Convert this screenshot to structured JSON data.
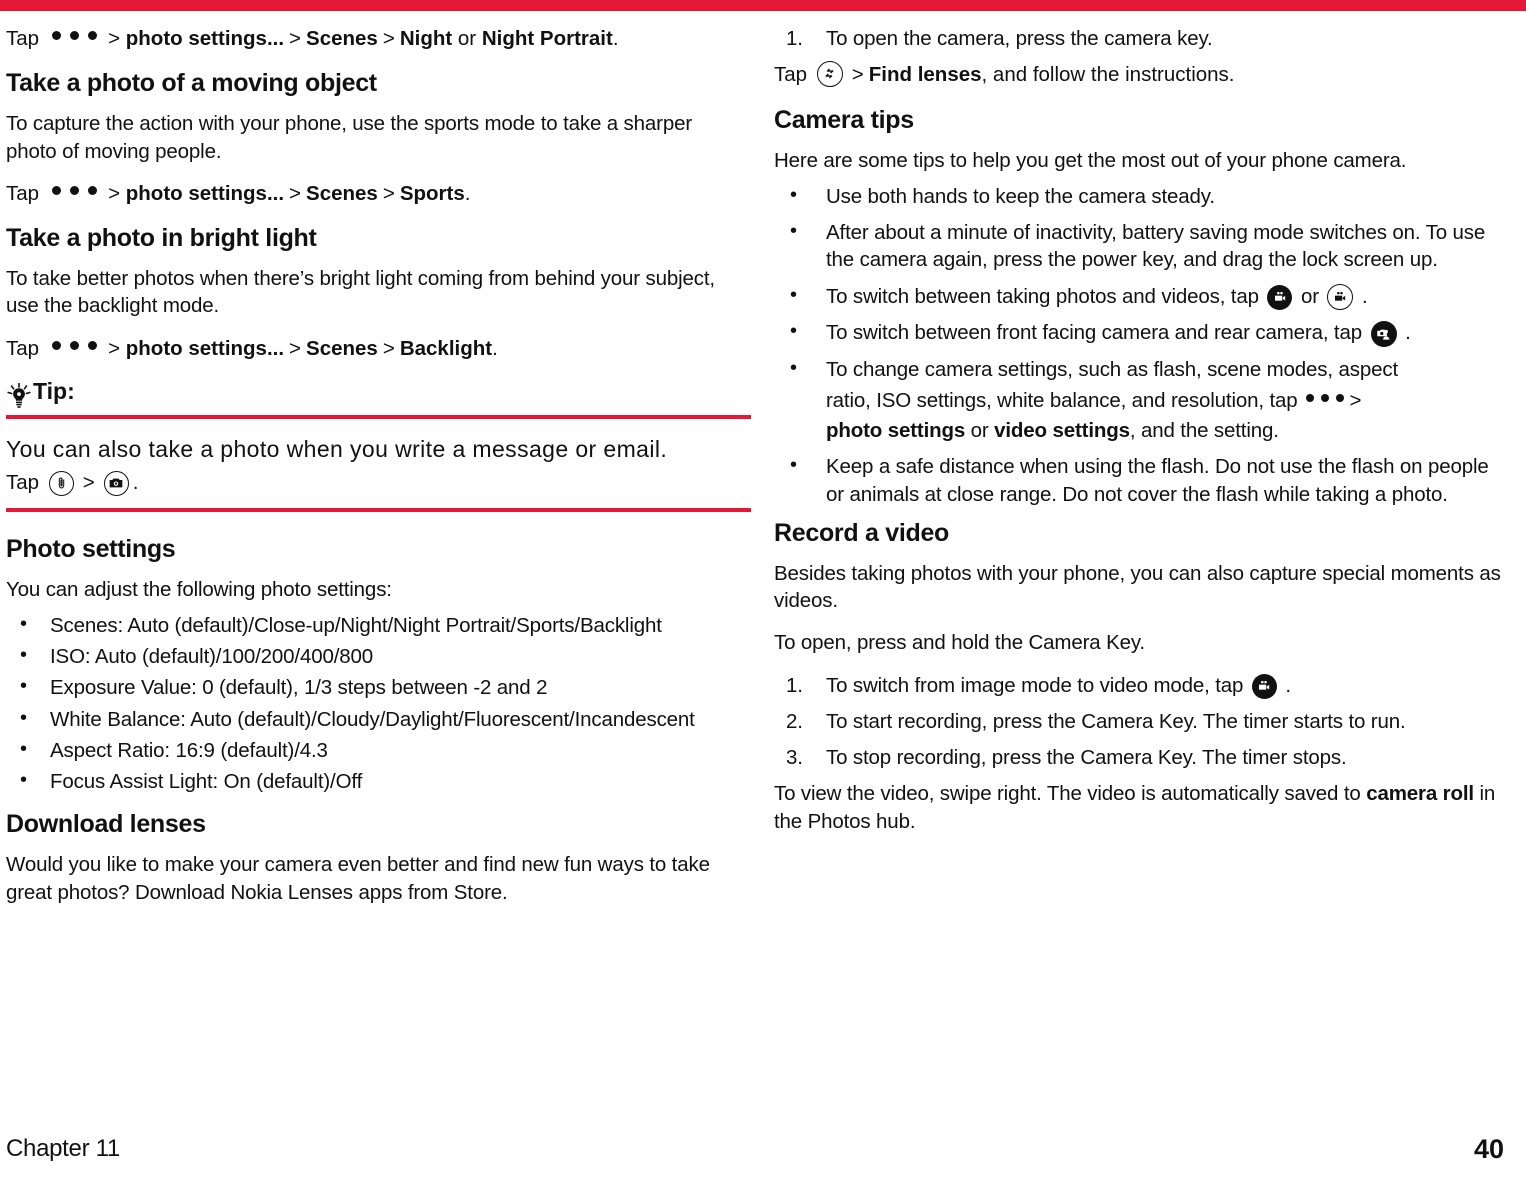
{
  "colors": {
    "accent": "#e31937",
    "text": "#111111"
  },
  "left": {
    "tap1": {
      "prefix": "Tap",
      "icon": "more-dots-icon",
      "sep": ">",
      "parts": [
        "photo settings...",
        "Scenes",
        "Night"
      ],
      "or_word": "or",
      "last": "Night Portrait",
      "period": "."
    },
    "h_moving": "Take a photo of a moving object",
    "p_moving": "To capture the action with your phone, use the sports mode to take a sharper photo of moving people.",
    "tap2": {
      "prefix": "Tap",
      "icon": "more-dots-icon",
      "sep": ">",
      "parts": [
        "photo settings...",
        "Scenes",
        "Sports"
      ],
      "period": "."
    },
    "h_bright": "Take a photo in bright light",
    "p_bright": "To take better photos when there’s bright light coming from behind your subject, use the backlight mode.",
    "tap3": {
      "prefix": "Tap",
      "icon": "more-dots-icon",
      "sep": ">",
      "parts": [
        "photo settings...",
        "Scenes",
        "Backlight"
      ],
      "period": "."
    },
    "tip_label": "Tip:",
    "tip_text": "You can also take a photo when you write a message or email.",
    "tip_tap_prefix": "Tap",
    "tip_sep": ">",
    "tip_period": ".",
    "h_photo_settings": "Photo settings",
    "p_photo_settings": "You can adjust the following photo settings:",
    "settings_items": [
      "Scenes: Auto (default)/Close-up/Night/Night Portrait/Sports/Backlight",
      "ISO: Auto (default)/100/200/400/800",
      "Exposure Value: 0 (default), 1/3 steps between -2 and 2",
      "White Balance: Auto (default)/Cloudy/Daylight/Fluorescent/Incandescent",
      "Aspect Ratio: 16:9 (default)/4.3",
      "Focus Assist Light: On (default)/Off"
    ],
    "h_download": "Download lenses",
    "p_download": "Would you like to make your camera even better and find new fun ways to take great photos? Download Nokia Lenses apps from Store."
  },
  "right": {
    "step1": "To open the camera, press the camera key.",
    "tap_lenses": {
      "prefix": "Tap",
      "icon": "swap-arrows-icon",
      "sep": ">",
      "bold": "Find lenses",
      "tail": ", and follow the instructions."
    },
    "h_tips": "Camera tips",
    "p_tips": "Here are some tips to help you get the most out of your phone camera.",
    "tip_items": [
      "Use both hands to keep the camera steady.",
      "After about a minute of inactivity, battery saving mode switches on. To use the camera again, press the power key, and drag the lock screen up."
    ],
    "tip_switch_photo_video": {
      "pre": "To switch between taking photos and videos, tap",
      "mid": "or",
      "post": "."
    },
    "tip_switch_front_rear": {
      "pre": "To switch between front facing camera and rear camera, tap",
      "post": "."
    },
    "tip_change_settings": {
      "line1": "To change camera settings, such as flash, scene modes, aspect",
      "line2_pre": "ratio, ISO settings, white balance, and resolution, tap",
      "sep": ">",
      "bold1": "photo settings",
      "or_word": "or",
      "bold2": "video settings",
      "tail": ", and the setting."
    },
    "tip_flash": "Keep a safe distance when using the flash. Do not use the flash on people or animals at close range. Do not cover the flash while taking a photo.",
    "h_record": "Record a video",
    "p_record": "Besides taking photos with your phone, you can also capture special moments as videos.",
    "p_open": "To open, press and hold the Camera Key.",
    "record_steps": [
      {
        "pre": "To switch from image mode to video mode, tap",
        "icon": "video-camera-icon",
        "post": "."
      },
      {
        "pre": "To start recording, press the Camera Key. The timer starts to run.",
        "icon": "",
        "post": ""
      },
      {
        "pre": "To stop recording, press the Camera Key. The timer stops.",
        "icon": "",
        "post": ""
      }
    ],
    "p_view_pre": "To view the video, swipe right. The video is automatically saved to ",
    "p_view_bold": "camera roll",
    "p_view_post": " in the Photos hub."
  },
  "footer": {
    "chapter": "Chapter 11",
    "page": "40"
  }
}
